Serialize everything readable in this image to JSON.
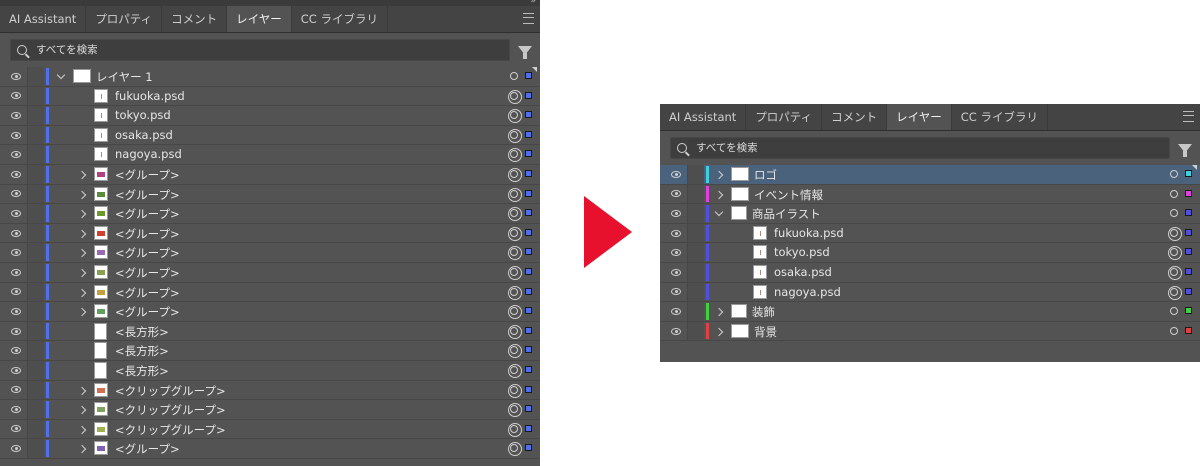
{
  "left_panel": {
    "tabs": [
      "AI Assistant",
      "プロパティ",
      "コメント",
      "レイヤー",
      "CC ライブラリ"
    ],
    "active_tab": 3,
    "search_placeholder": "すべてを検索",
    "rows": [
      {
        "name": "レイヤー 1",
        "indent": 0,
        "toggle": "down",
        "thumb": "wide",
        "target": "single",
        "corner": true
      },
      {
        "name": "fukuoka.psd",
        "indent": 1,
        "toggle": "none",
        "thumb": "psd",
        "target": "double"
      },
      {
        "name": "tokyo.psd",
        "indent": 1,
        "toggle": "none",
        "thumb": "psd",
        "target": "double"
      },
      {
        "name": "osaka.psd",
        "indent": 1,
        "toggle": "none",
        "thumb": "psd",
        "target": "double"
      },
      {
        "name": "nagoya.psd",
        "indent": 1,
        "toggle": "none",
        "thumb": "psd",
        "target": "double"
      },
      {
        "name": "<グループ>",
        "indent": 1,
        "toggle": "right",
        "thumb": "group",
        "art": "#b04080",
        "target": "double"
      },
      {
        "name": "<グループ>",
        "indent": 1,
        "toggle": "right",
        "thumb": "group",
        "art": "#5a8a3a",
        "target": "double"
      },
      {
        "name": "<グループ>",
        "indent": 1,
        "toggle": "right",
        "thumb": "group",
        "art": "#6a9a2a",
        "target": "double"
      },
      {
        "name": "<グループ>",
        "indent": 1,
        "toggle": "right",
        "thumb": "group",
        "art": "#d04030",
        "target": "double"
      },
      {
        "name": "<グループ>",
        "indent": 1,
        "toggle": "right",
        "thumb": "group",
        "art": "#9a6ab0",
        "target": "double"
      },
      {
        "name": "<グループ>",
        "indent": 1,
        "toggle": "right",
        "thumb": "group",
        "art": "#8aa050",
        "target": "double"
      },
      {
        "name": "<グループ>",
        "indent": 1,
        "toggle": "right",
        "thumb": "group",
        "art": "#c0a040",
        "target": "double"
      },
      {
        "name": "<グループ>",
        "indent": 1,
        "toggle": "right",
        "thumb": "group",
        "art": "#60a060",
        "target": "double"
      },
      {
        "name": "<長方形>",
        "indent": 1,
        "toggle": "none",
        "thumb": "rect",
        "target": "double"
      },
      {
        "name": "<長方形>",
        "indent": 1,
        "toggle": "none",
        "thumb": "rect",
        "target": "double"
      },
      {
        "name": "<長方形>",
        "indent": 1,
        "toggle": "none",
        "thumb": "rect",
        "target": "double"
      },
      {
        "name": "<クリップグループ>",
        "indent": 1,
        "toggle": "right",
        "thumb": "group",
        "art": "#d07050",
        "target": "double"
      },
      {
        "name": "<クリップグループ>",
        "indent": 1,
        "toggle": "right",
        "thumb": "group",
        "art": "#80a060",
        "target": "double"
      },
      {
        "name": "<クリップグループ>",
        "indent": 1,
        "toggle": "right",
        "thumb": "group",
        "art": "#a0b050",
        "target": "double"
      },
      {
        "name": "<グループ>",
        "indent": 1,
        "toggle": "right",
        "thumb": "group",
        "art": "#8060b0",
        "target": "double"
      }
    ],
    "bar_color": "#4f6ef0",
    "square_color": "#4f6ef0"
  },
  "right_panel": {
    "tabs": [
      "AI Assistant",
      "プロパティ",
      "コメント",
      "レイヤー",
      "CC ライブラリ"
    ],
    "active_tab": 3,
    "search_placeholder": "すべてを検索",
    "rows": [
      {
        "name": "ロゴ",
        "indent": 0,
        "toggle": "right",
        "thumb": "wide",
        "target": "single",
        "color": "#3fd0e0",
        "selected": true,
        "corner": true
      },
      {
        "name": "イベント情報",
        "indent": 0,
        "toggle": "right",
        "thumb": "wide",
        "target": "single",
        "color": "#e040e0"
      },
      {
        "name": "商品イラスト",
        "indent": 0,
        "toggle": "down",
        "thumb": "square",
        "target": "single",
        "color": "#4f4fe0"
      },
      {
        "name": "fukuoka.psd",
        "indent": 1,
        "toggle": "none",
        "thumb": "psd",
        "target": "double",
        "color": "#4f4fe0"
      },
      {
        "name": "tokyo.psd",
        "indent": 1,
        "toggle": "none",
        "thumb": "psd",
        "target": "double",
        "color": "#4f4fe0"
      },
      {
        "name": "osaka.psd",
        "indent": 1,
        "toggle": "none",
        "thumb": "psd",
        "target": "double",
        "color": "#4f4fe0"
      },
      {
        "name": "nagoya.psd",
        "indent": 1,
        "toggle": "none",
        "thumb": "psd",
        "target": "double",
        "color": "#4f4fe0"
      },
      {
        "name": "装飾",
        "indent": 0,
        "toggle": "right",
        "thumb": "square",
        "target": "single",
        "color": "#40d040"
      },
      {
        "name": "背景",
        "indent": 0,
        "toggle": "right",
        "thumb": "wide",
        "target": "single",
        "color": "#e04040"
      }
    ]
  },
  "colors": {
    "panel_bg": "#535353",
    "selected_row": "#4b627c",
    "arrow": "#e8112d"
  }
}
